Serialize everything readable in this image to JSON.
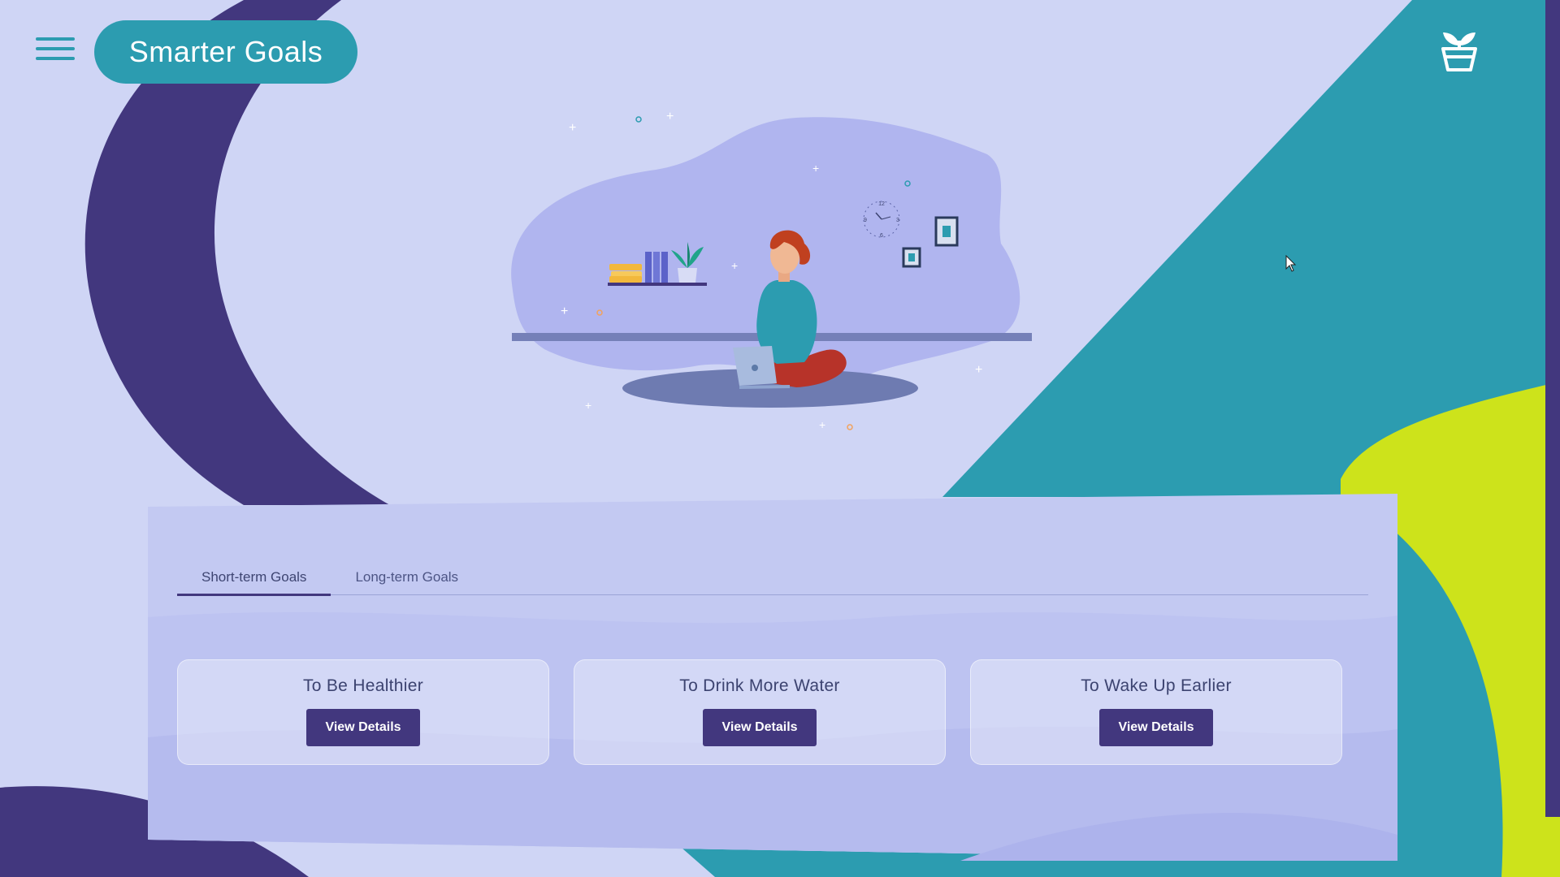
{
  "header": {
    "app_title": "Smarter Goals",
    "menu_icon": "hamburger-menu-icon",
    "plant_icon": "potted-plant-icon"
  },
  "illustration": {
    "subject": "woman-sitting-with-laptop",
    "clock_numbers": [
      "12",
      "3",
      "6",
      "9"
    ]
  },
  "tabs": [
    {
      "label": "Short-term Goals",
      "active": true
    },
    {
      "label": "Long-term Goals",
      "active": false
    }
  ],
  "goals": [
    {
      "title": "To Be Healthier",
      "button": "View Details"
    },
    {
      "title": "To Drink More Water",
      "button": "View Details"
    },
    {
      "title": "To Wake Up Earlier",
      "button": "View Details"
    }
  ],
  "colors": {
    "background": "#cfd5f5",
    "teal": "#2c9cb0",
    "indigo": "#42377e",
    "lime": "#cde31b",
    "panel": "#c3c9f2"
  }
}
